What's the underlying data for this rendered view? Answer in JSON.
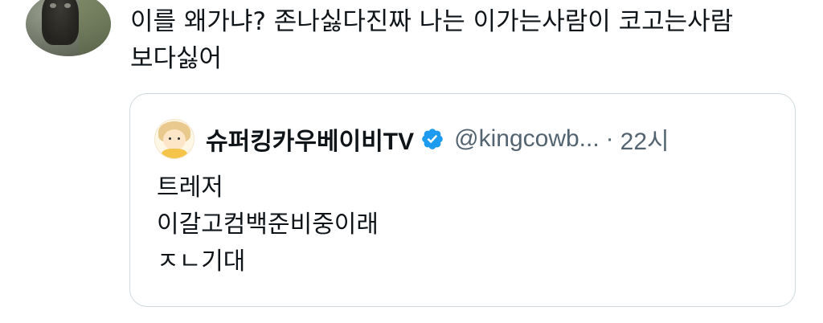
{
  "tweet": {
    "avatar_icon": "user-avatar-dog",
    "text": "이를 왜가냐? 존나싫다진짜 나는 이가는사람이 코고는사람\n보다싫어"
  },
  "quote": {
    "avatar_icon": "user-avatar-cartoon-child",
    "display_name": "슈퍼킹카우베이비TV",
    "verified_icon": "verified-badge-icon",
    "handle": "@kingcowb...",
    "separator": "·",
    "time": "22시",
    "text": "트레저\n이갈고컴백준비중이래\nㅈㄴ기대"
  },
  "colors": {
    "verified": "#1d9bf0",
    "secondary_text": "#536471",
    "border": "#cfd9de"
  }
}
